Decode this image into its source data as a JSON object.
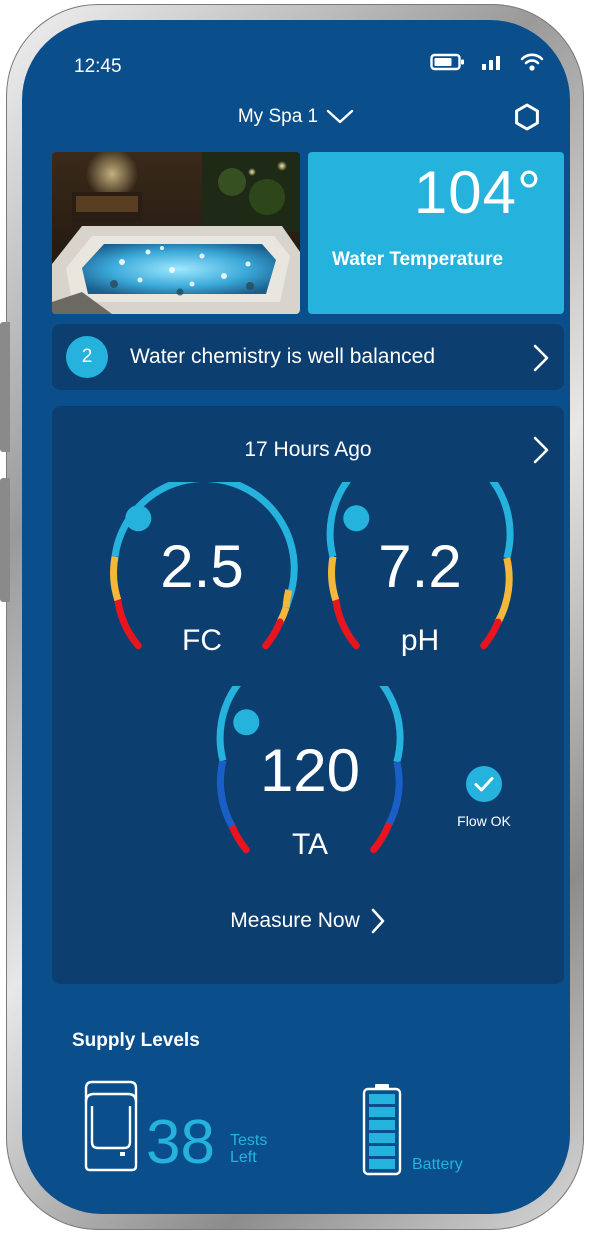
{
  "status_bar": {
    "time": "12:45",
    "icons": [
      "battery-icon",
      "signal-icon",
      "wifi-icon"
    ]
  },
  "header": {
    "title": "My Spa 1",
    "dropdown_icon": "chevron-down-icon",
    "settings_icon": "gear-icon"
  },
  "temperature": {
    "value": "104°",
    "label": "Water Temperature"
  },
  "alert": {
    "count": "2",
    "message": "Water chemistry is well balanced"
  },
  "chemistry": {
    "last_measured": "17 Hours Ago",
    "gauges": [
      {
        "id": "fc",
        "value": "2.5",
        "label": "FC"
      },
      {
        "id": "ph",
        "value": "7.2",
        "label": "pH"
      },
      {
        "id": "ta",
        "value": "120",
        "label": "TA"
      }
    ],
    "flow_status": "Flow OK",
    "measure_action": "Measure Now"
  },
  "supply": {
    "title": "Supply Levels",
    "tests_left": "38",
    "tests_label_line1": "Tests",
    "tests_label_line2": "Left",
    "battery_label": "Battery"
  },
  "colors": {
    "background": "#0a4f8c",
    "card": "#0c3f70",
    "accent": "#25b2dc",
    "warning": "#f4b73a",
    "danger": "#e8141e",
    "deep_blue": "#1a5fc8"
  }
}
